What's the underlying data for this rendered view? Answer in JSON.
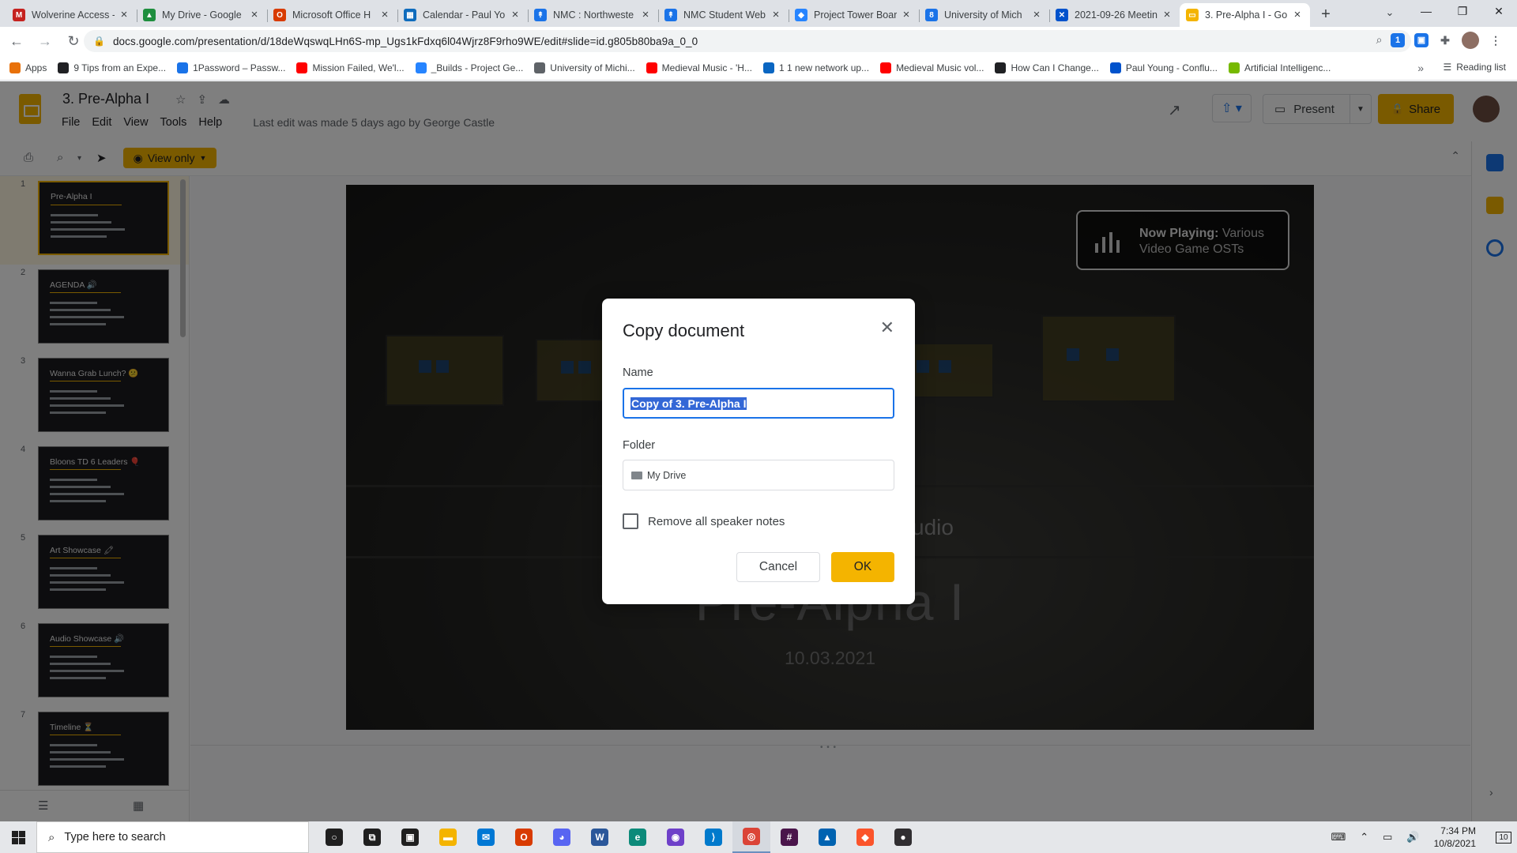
{
  "browser": {
    "tabs": [
      {
        "title": "Wolverine Access - ",
        "icon": "gmail-icon",
        "color": "#c5221f",
        "glyph": "M"
      },
      {
        "title": "My Drive - Google ",
        "icon": "google-drive-icon",
        "color": "#1e8e3e",
        "glyph": "▲"
      },
      {
        "title": "Microsoft Office H",
        "icon": "office-icon",
        "color": "#d83b01",
        "glyph": "O"
      },
      {
        "title": "Calendar - Paul Yo",
        "icon": "outlook-calendar-icon",
        "color": "#0f6cbd",
        "glyph": "▦"
      },
      {
        "title": "NMC : Northweste",
        "icon": "nmc-icon",
        "color": "#1a73e8",
        "glyph": "↟"
      },
      {
        "title": "NMC Student Web",
        "icon": "nmc-icon",
        "color": "#1a73e8",
        "glyph": "↟"
      },
      {
        "title": "Project Tower Boar",
        "icon": "jira-icon",
        "color": "#2684ff",
        "glyph": "◆"
      },
      {
        "title": "University of Mich",
        "icon": "umich-icon",
        "color": "#1a73e8",
        "glyph": "8"
      },
      {
        "title": "2021-09-26 Meetin",
        "icon": "confluence-icon",
        "color": "#0052cc",
        "glyph": "✕"
      },
      {
        "title": "3. Pre-Alpha I - Go",
        "icon": "google-slides-icon",
        "color": "#f4b400",
        "glyph": "▭",
        "active": true
      }
    ],
    "url": "docs.google.com/presentation/d/18deWqswqLHn6S-mp_Ugs1kFdxq6l04Wjrz8F9rho9WE/edit#slide=id.g805b80ba9a_0_0",
    "bookmarks": [
      {
        "label": "Apps",
        "color": "#e8710a"
      },
      {
        "label": "9 Tips from an Expe...",
        "color": "#202124"
      },
      {
        "label": "1Password – Passw...",
        "color": "#1a73e8"
      },
      {
        "label": "Mission Failed, We'l...",
        "color": "#ff0000"
      },
      {
        "label": "_Builds - Project Ge...",
        "color": "#2684ff"
      },
      {
        "label": "University of Michi...",
        "color": "#5f6368"
      },
      {
        "label": "Medieval Music - 'H...",
        "color": "#ff0000"
      },
      {
        "label": "1 1 new network up...",
        "color": "#0a66c2"
      },
      {
        "label": "Medieval Music vol...",
        "color": "#ff0000"
      },
      {
        "label": "How Can I Change...",
        "color": "#202124"
      },
      {
        "label": "Paul Young - Conflu...",
        "color": "#0052cc"
      },
      {
        "label": "Artificial Intelligenc...",
        "color": "#76b900"
      }
    ],
    "more_bookmarks": "»",
    "reading_list": "Reading list"
  },
  "slides": {
    "doc_title": "3. Pre-Alpha I",
    "menu": [
      "File",
      "Edit",
      "View",
      "Tools",
      "Help"
    ],
    "last_edit": "Last edit was made 5 days ago by George Castle",
    "present_label": "Present",
    "share_label": "Share",
    "view_only_label": "View only",
    "thumbnails": [
      {
        "num": "1",
        "title": "Pre-Alpha I"
      },
      {
        "num": "2",
        "title": "AGENDA 🔊"
      },
      {
        "num": "3",
        "title": "Wanna Grab Lunch? 😕"
      },
      {
        "num": "4",
        "title": "Bloons TD 6 Leaders 🎈"
      },
      {
        "num": "5",
        "title": "Art Showcase 🖍"
      },
      {
        "num": "6",
        "title": "Audio Showcase 🔊"
      },
      {
        "num": "7",
        "title": "Timeline ⏳"
      }
    ],
    "slide": {
      "now_playing_label": "Now Playing:",
      "now_playing_text": "Various Video Game OSTs",
      "studio_fragment": "udio",
      "title": "Pre-Alpha I",
      "date": "10.03.2021"
    }
  },
  "dialog": {
    "title": "Copy document",
    "name_label": "Name",
    "name_value": "Copy of 3. Pre-Alpha I",
    "folder_label": "Folder",
    "folder_value": "My Drive",
    "remove_notes_label": "Remove all speaker notes",
    "remove_notes_checked": false,
    "cancel_label": "Cancel",
    "ok_label": "OK"
  },
  "taskbar": {
    "search_placeholder": "Type here to search",
    "time": "7:34 PM",
    "date": "10/8/2021",
    "notification_count": "10",
    "apps": [
      {
        "name": "cortana-icon",
        "glyph": "○",
        "color": "#1f1f1f"
      },
      {
        "name": "task-view-icon",
        "glyph": "⧉",
        "color": "#1f1f1f"
      },
      {
        "name": "store-icon",
        "glyph": "▣",
        "color": "#1f1f1f"
      },
      {
        "name": "file-explorer-icon",
        "glyph": "▬",
        "color": "#f4b400"
      },
      {
        "name": "mail-icon",
        "glyph": "✉",
        "color": "#0078d4"
      },
      {
        "name": "office-icon",
        "glyph": "O",
        "color": "#d83b01"
      },
      {
        "name": "discord-icon",
        "glyph": "◕",
        "color": "#5865f2"
      },
      {
        "name": "word-icon",
        "glyph": "W",
        "color": "#2b579a"
      },
      {
        "name": "edge-icon",
        "glyph": "e",
        "color": "#0c8a7a"
      },
      {
        "name": "github-icon",
        "glyph": "◉",
        "color": "#6e40c9"
      },
      {
        "name": "vscode-icon",
        "glyph": "⟩",
        "color": "#007acc"
      },
      {
        "name": "chrome-icon",
        "glyph": "◎",
        "color": "#db4437"
      },
      {
        "name": "slack-icon",
        "glyph": "#",
        "color": "#4a154b"
      },
      {
        "name": "photos-icon",
        "glyph": "▲",
        "color": "#0063b1"
      },
      {
        "name": "brave-icon",
        "glyph": "◆",
        "color": "#fb542b"
      },
      {
        "name": "obs-icon",
        "glyph": "●",
        "color": "#302e31"
      }
    ]
  }
}
